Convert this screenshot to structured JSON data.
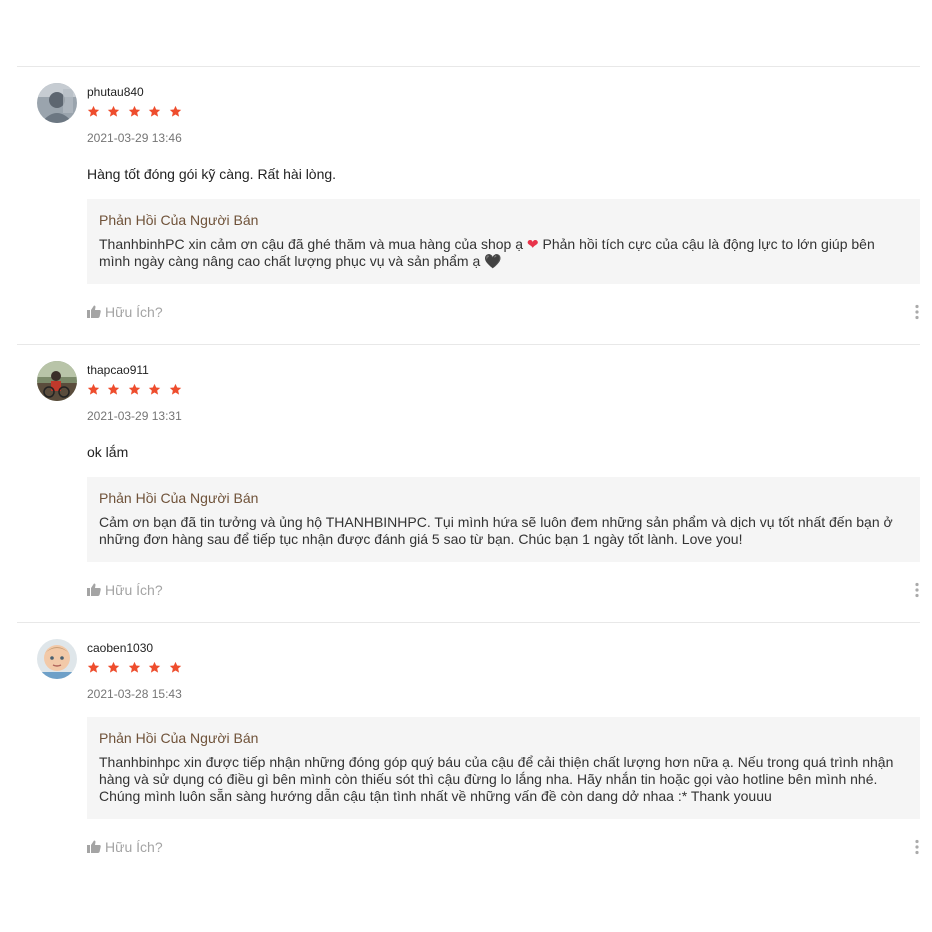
{
  "reviews": [
    {
      "username": "phutau840",
      "rating": 5,
      "time": "2021-03-29 13:46",
      "comment": "Hàng tốt đóng gói kỹ càng. Rất hài lòng.",
      "seller_title": "Phản Hồi Của Người Bán",
      "seller_text_a": "ThanhbinhPC xin cảm ơn cậu đã ghé thăm và mua hàng của shop ạ ",
      "seller_heart": "❤",
      "seller_text_b": " Phản hồi tích cực của cậu là động lực to lớn giúp bên mình ngày càng nâng cao chất lượng phục vụ và sản phẩm ạ ",
      "seller_heart2": "🖤",
      "helpful": "Hữu Ích?"
    },
    {
      "username": "thapcao911",
      "rating": 5,
      "time": "2021-03-29 13:31",
      "comment": "ok lắm",
      "seller_title": "Phản Hồi Của Người Bán",
      "seller_text": "Cảm ơn bạn đã tin tưởng và ủng hộ THANHBINHPC. Tụi mình hứa sẽ luôn đem những sản phẩm và dịch vụ tốt nhất đến bạn ở những đơn hàng sau để tiếp tục nhận được đánh giá 5 sao từ bạn. Chúc bạn 1 ngày tốt lành. Love you!",
      "helpful": "Hữu Ích?"
    },
    {
      "username": "caoben1030",
      "rating": 5,
      "time": "2021-03-28 15:43",
      "seller_title": "Phản Hồi Của Người Bán",
      "seller_text": "Thanhbinhpc xin được tiếp nhận những đóng góp quý báu của cậu để cải thiện chất lượng hơn nữa ạ. Nếu trong quá trình nhận hàng và sử dụng có điều gì bên mình còn thiếu sót thì cậu đừng lo lắng nha. Hãy nhắn tin hoặc gọi vào hotline bên mình nhé. Chúng mình luôn sẵn sàng hướng dẫn cậu tận tình nhất về những vấn đề còn dang dở nhaa :* Thank youuu",
      "helpful": "Hữu Ích?"
    }
  ],
  "colors": {
    "star": "#ee4d2d",
    "seller_title": "#6f5239",
    "reply_bg": "#f5f5f5",
    "muted": "#a4a4a4"
  },
  "icons": {
    "star": "star-icon",
    "thumb": "thumbs-up-icon",
    "more": "more-vertical-icon"
  }
}
